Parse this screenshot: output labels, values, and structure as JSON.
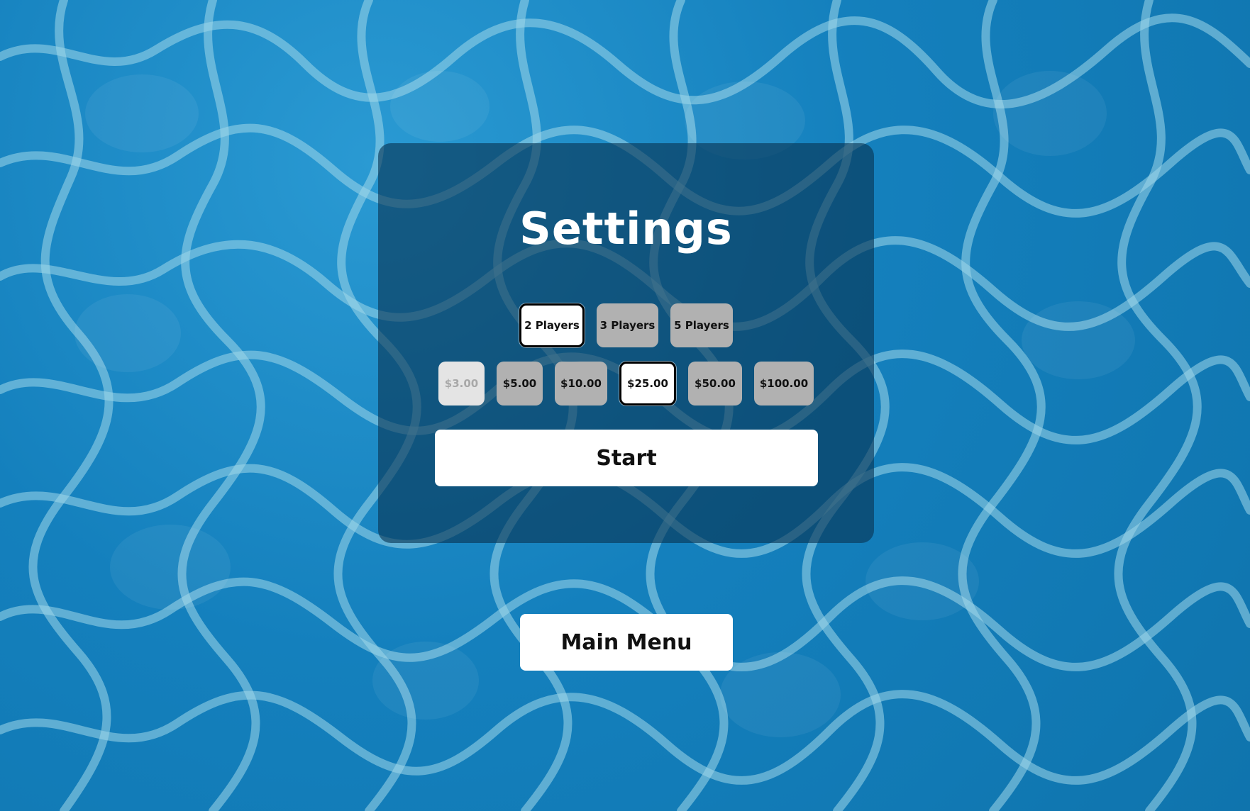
{
  "screen": {
    "title": "Settings"
  },
  "players": {
    "options": [
      "2 Players",
      "3 Players",
      "5 Players"
    ],
    "selected": "2 Players"
  },
  "stakes": {
    "options": [
      "$3.00",
      "$5.00",
      "$10.00",
      "$25.00",
      "$50.00",
      "$100.00"
    ],
    "selected": "$25.00",
    "disabled": [
      "$3.00"
    ]
  },
  "actions": {
    "start_label": "Start",
    "main_menu_label": "Main Menu"
  },
  "colors": {
    "water": "#1480bd",
    "panel": "#083452",
    "chip": "#b1b1b1",
    "chip_disabled": "#e4e4e4",
    "selected_border": "#000000"
  }
}
